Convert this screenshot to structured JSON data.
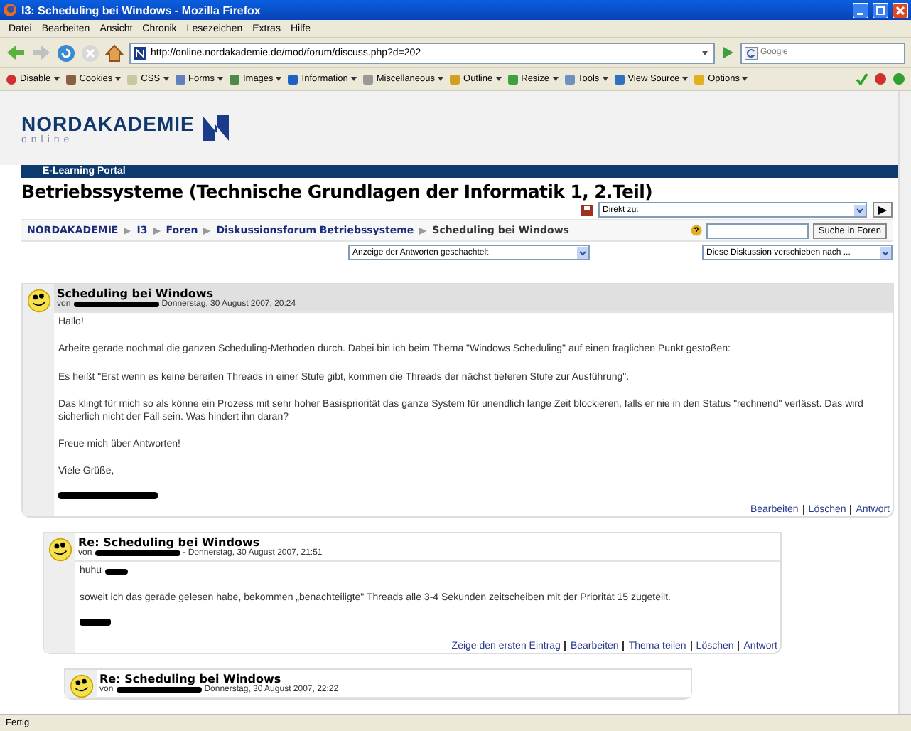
{
  "window": {
    "title": "I3: Scheduling bei Windows - Mozilla Firefox"
  },
  "menu": [
    "Datei",
    "Bearbeiten",
    "Ansicht",
    "Chronik",
    "Lesezeichen",
    "Extras",
    "Hilfe"
  ],
  "nav": {
    "url": "http://online.nordakademie.de/mod/forum/discuss.php?d=202",
    "search_placeholder": "Google"
  },
  "webdev_toolbar": [
    {
      "label": "Disable",
      "kind": "disable"
    },
    {
      "label": "Cookies",
      "kind": "cookies"
    },
    {
      "label": "CSS",
      "kind": "css"
    },
    {
      "label": "Forms",
      "kind": "forms"
    },
    {
      "label": "Images",
      "kind": "images"
    },
    {
      "label": "Information",
      "kind": "information"
    },
    {
      "label": "Miscellaneous",
      "kind": "misc"
    },
    {
      "label": "Outline",
      "kind": "outline"
    },
    {
      "label": "Resize",
      "kind": "resize"
    },
    {
      "label": "Tools",
      "kind": "tools"
    },
    {
      "label": "View Source",
      "kind": "source"
    },
    {
      "label": "Options",
      "kind": "options"
    }
  ],
  "site": {
    "logo_text": "NORDAKADEMIE",
    "logo_sub": "online",
    "portal_label": "E-Learning Portal",
    "course_title": "Betriebssysteme (Technische Grundlagen der Informatik 1, 2.Teil)",
    "jump_label": "Direkt zu:",
    "breadcrumb": [
      "NORDAKADEMIE",
      "I3",
      "Foren",
      "Diskussionsforum Betriebssysteme",
      "Scheduling bei Windows"
    ],
    "search_button": "Suche in Foren",
    "display_select": "Anzeige der Antworten geschachtelt",
    "move_select": "Diese Diskussion verschieben nach ..."
  },
  "posts": [
    {
      "subject": "Scheduling bei Windows",
      "by": "von",
      "date": "Donnerstag, 30 August 2007, 20:24",
      "body": [
        {
          "text": "Hallo!",
          "redacted": false
        },
        {
          "text": "Arbeite gerade nochmal die ganzen Scheduling-Methoden durch. Dabei bin ich beim Thema \"Windows Scheduling\" auf einen fraglichen Punkt gestoßen:",
          "redacted": false
        },
        {
          "text": "Es heißt \"Erst wenn es keine bereiten Threads in einer Stufe gibt, kommen die Threads der nächst tieferen Stufe zur Ausführung\".",
          "redacted": false
        },
        {
          "text": "Das klingt für mich so als könne ein Prozess mit sehr hoher Basispriorität das ganze System für unendlich lange Zeit blockieren, falls er nie in den Status \"rechnend\" verlässt. Das wird sicherlich nicht der Fall sein. Was hindert ihn daran?",
          "redacted": false
        },
        {
          "text": "Freue mich über Antworten!",
          "redacted": false
        },
        {
          "text": "Viele Grüße,",
          "redacted": false
        },
        {
          "redacted": true
        }
      ],
      "actions": [
        "Bearbeiten",
        "Löschen",
        "Antwort"
      ],
      "children": [
        {
          "subject": "Re: Scheduling bei Windows",
          "by": "von",
          "date": "- Donnerstag, 30 August 2007, 21:51",
          "body": [
            {
              "text": "huhu",
              "redacted": true
            },
            {
              "text": "soweit ich das gerade gelesen habe, bekommen „benachteiligte\" Threads alle 3-4 Sekunden zeitscheiben mit der Priorität 15 zugeteilt.",
              "redacted": false
            },
            {
              "redacted": true
            }
          ],
          "actions": [
            "Zeige den ersten Eintrag",
            "Bearbeiten",
            "Thema teilen",
            "Löschen",
            "Antwort"
          ],
          "children": [
            {
              "subject": "Re: Scheduling bei Windows",
              "by": "von",
              "date": "Donnerstag, 30 August 2007, 22:22"
            }
          ]
        }
      ]
    }
  ],
  "status_bar": "Fertig"
}
